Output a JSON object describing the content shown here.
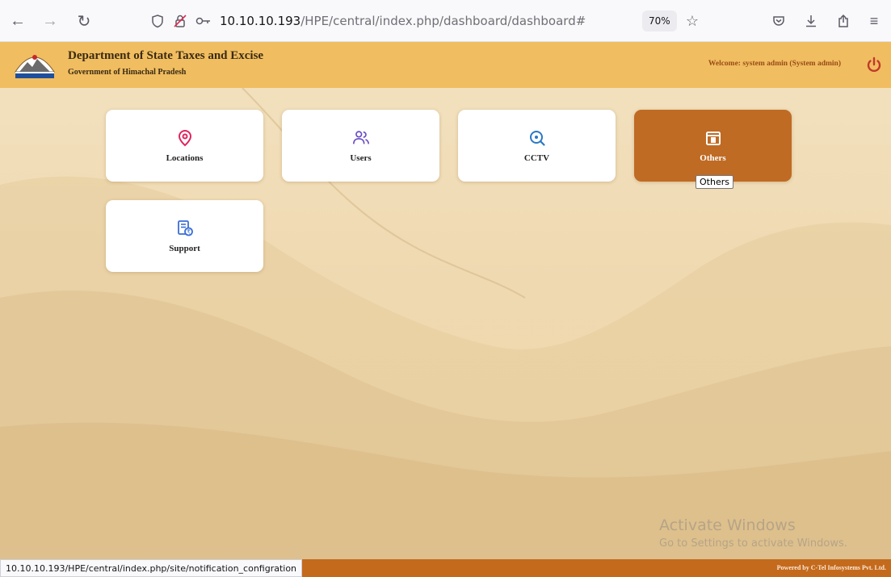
{
  "browser": {
    "url_host": "10.10.10.193",
    "url_path": "/HPE/central/index.php/dashboard/dashboard#",
    "zoom": "70%"
  },
  "header": {
    "title": "Department of State Taxes and Excise",
    "subtitle": "Government of Himachal Pradesh",
    "welcome": "Welcome: system admin (System admin)"
  },
  "tiles": [
    {
      "label": "Locations",
      "icon": "location-pin-icon",
      "color": "#e0245e"
    },
    {
      "label": "Users",
      "icon": "users-icon",
      "color": "#6a4bc4"
    },
    {
      "label": "CCTV",
      "icon": "search-icon",
      "color": "#2a78c4"
    },
    {
      "label": "Others",
      "icon": "folder-icon",
      "color": "#ffffff"
    },
    {
      "label": "Support",
      "icon": "receipt-icon",
      "color": "#3b6fd4"
    }
  ],
  "tooltip": "Others",
  "watermark": {
    "line1": "Activate Windows",
    "line2": "Go to Settings to activate Windows."
  },
  "footer": {
    "status_url": "10.10.10.193/HPE/central/index.php/site/notification_configration",
    "powered_by": "Powered by C-Tel Infosystems Pvt. Ltd."
  },
  "colors": {
    "header_bg": "#f0bd61",
    "accent": "#bf6b24",
    "footer_bg": "#c46a1d"
  }
}
